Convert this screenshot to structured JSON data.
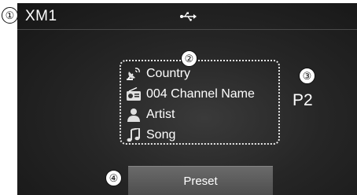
{
  "header": {
    "title": "XM1",
    "connection_icon": "usb-icon"
  },
  "callouts": [
    "①",
    "②",
    "③",
    "④"
  ],
  "info": {
    "category": "Country",
    "channel": "004 Channel Name",
    "artist": "Artist",
    "song": "Song"
  },
  "preset": {
    "number": "P2",
    "button_label": "Preset"
  },
  "colors": {
    "screen_bg": "#262626",
    "text": "#ffffff",
    "button_bg": "#5a5a5a"
  }
}
